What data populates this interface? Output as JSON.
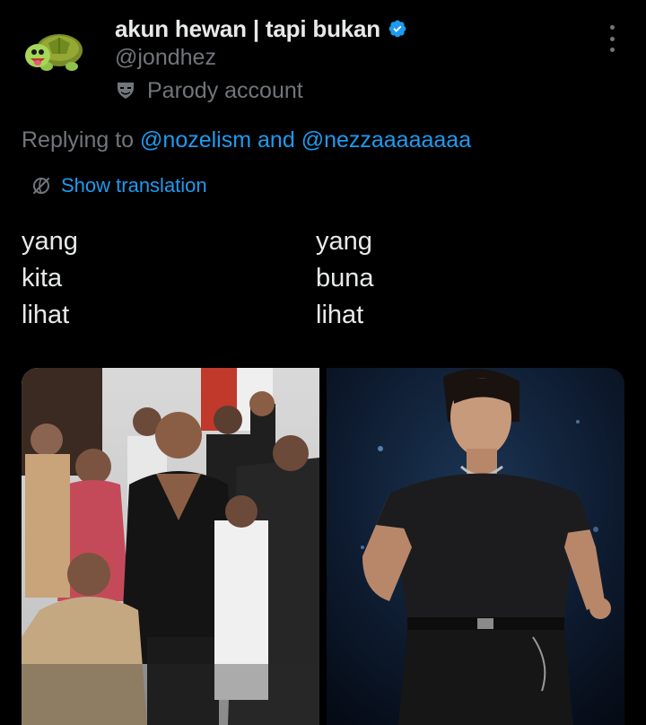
{
  "header": {
    "display_name": "akun hewan | tapi bukan",
    "handle": "@jondhez",
    "verified": true,
    "account_label": "Parody account",
    "avatar_icon": "turtle-emoji-avatar",
    "accent_color": "#1d9bf0"
  },
  "reply": {
    "prefix": "Replying to",
    "mentions": [
      "@nozelism",
      "@nezzaaaaaaaa"
    ],
    "joiner": "and"
  },
  "translation": {
    "label": "Show translation",
    "icon": "translate-icon"
  },
  "tweet": {
    "left_column": [
      "yang",
      "kita",
      "lihat"
    ],
    "right_column": [
      "yang",
      "buna",
      "lihat"
    ]
  },
  "media": {
    "count": 2,
    "photos": [
      {
        "icon": "photo-rally-crowd"
      },
      {
        "icon": "photo-stage-performer"
      }
    ]
  },
  "colors": {
    "background": "#000000",
    "text_primary": "#e7e9ea",
    "text_secondary": "#71767b",
    "link": "#1d9bf0"
  }
}
